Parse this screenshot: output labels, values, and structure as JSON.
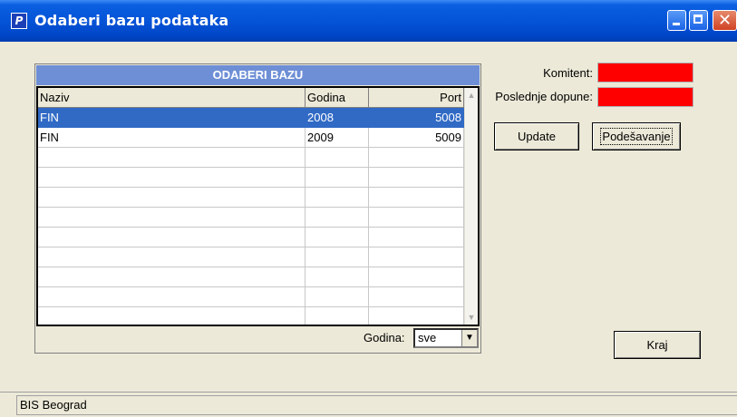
{
  "window": {
    "title": "Odaberi bazu podataka",
    "icon": "app-icon",
    "icon_glyph": "P",
    "controls": {
      "minimize": "minimize-icon",
      "maximize": "maximize-icon",
      "close": "close-icon",
      "close_glyph": "✕"
    }
  },
  "panel": {
    "title": "ODABERI BAZU",
    "columns": [
      "Naziv",
      "Godina",
      "Port"
    ],
    "rows": [
      {
        "naziv": "FIN",
        "godina": "2008",
        "port": "5008",
        "selected": true
      },
      {
        "naziv": "FIN",
        "godina": "2009",
        "port": "5009",
        "selected": false
      }
    ],
    "empty_rows": 9,
    "scroll_up_glyph": "▲",
    "scroll_down_glyph": "▼",
    "filter": {
      "label": "Godina:",
      "value": "sve",
      "arrow": "▼"
    }
  },
  "info": {
    "komitent_label": "Komitent:",
    "dopune_label": "Poslednje dopune:",
    "komitent_value": "",
    "dopune_value": "",
    "field_color": "#ff0000"
  },
  "buttons": {
    "update": "Update",
    "podesavanje": "Podešavanje",
    "kraj": "Kraj"
  },
  "status": {
    "text": "BIS Beograd"
  },
  "colors": {
    "selection": "#316ac5",
    "header_bar": "#6e8fd6",
    "titlebar": "#0554d8"
  }
}
